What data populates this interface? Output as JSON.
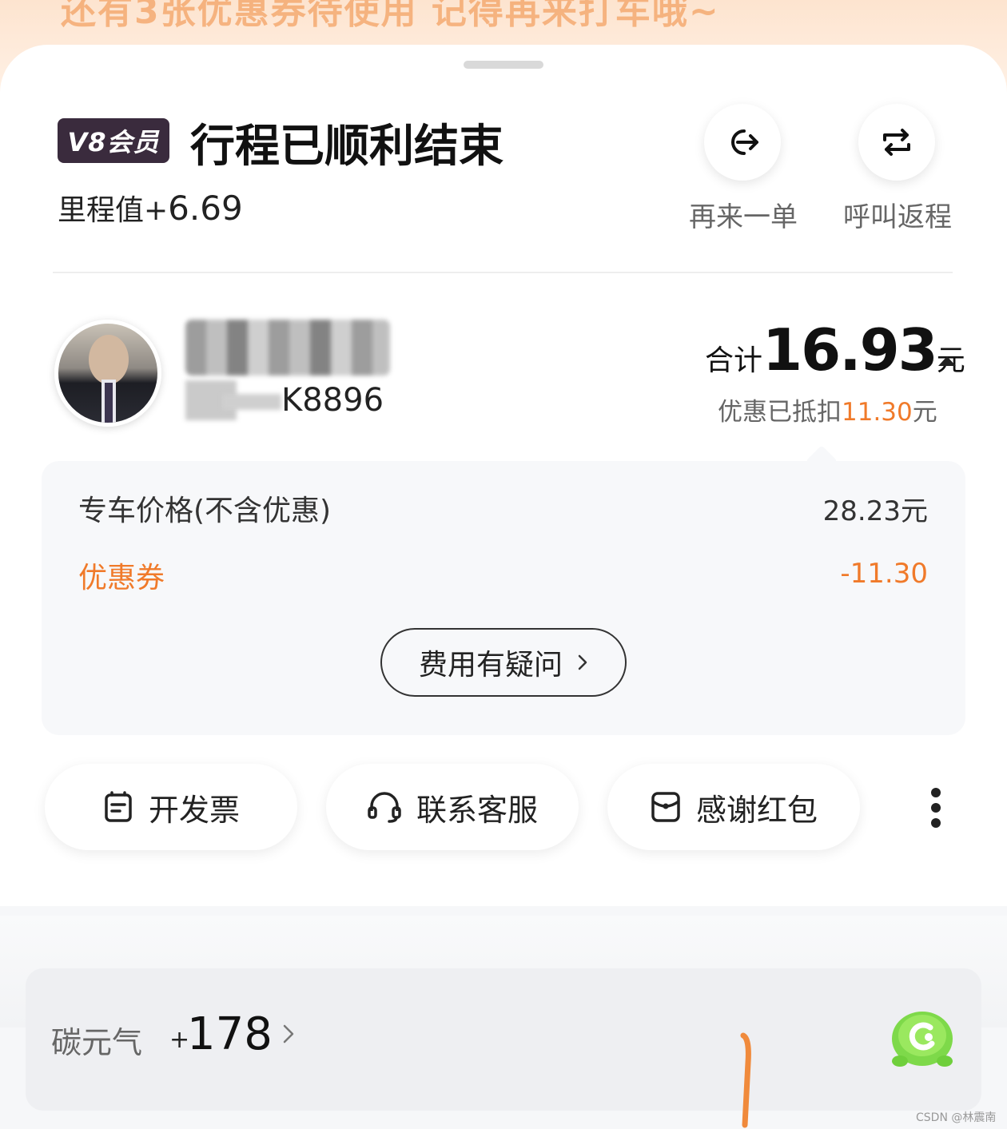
{
  "banner": {
    "text": "还有3张优惠券待使用 记得再来打车哦~"
  },
  "header": {
    "vip_badge": "V8会员",
    "title": "行程已顺利结束",
    "mileage_label": "里程值+",
    "mileage_value": "6.69"
  },
  "actions": {
    "again_label": "再来一单",
    "return_label": "呼叫返程"
  },
  "driver": {
    "plate_suffix": "K8896"
  },
  "fare": {
    "total_label": "合计",
    "total_amount": "16.93",
    "total_unit": "元",
    "discount_prefix": "优惠已抵扣",
    "discount_amount": "11.30",
    "discount_unit": "元"
  },
  "details": {
    "rows": [
      {
        "label": "专车价格(不含优惠)",
        "value": "28.23元"
      },
      {
        "label": "优惠券",
        "value": "-11.30"
      }
    ],
    "fee_question": "费用有疑问"
  },
  "bottom_actions": {
    "invoice": "开发票",
    "customer_service": "联系客服",
    "thanks_redpacket": "感谢红包"
  },
  "carbon": {
    "label": "碳元气",
    "plus": "+",
    "value": "178"
  },
  "watermark": "CSDN @林震南",
  "colors": {
    "accent_orange": "#f07a2a",
    "vip_badge_bg": "#3a2b3d",
    "mascot_green": "#7ed94a"
  }
}
